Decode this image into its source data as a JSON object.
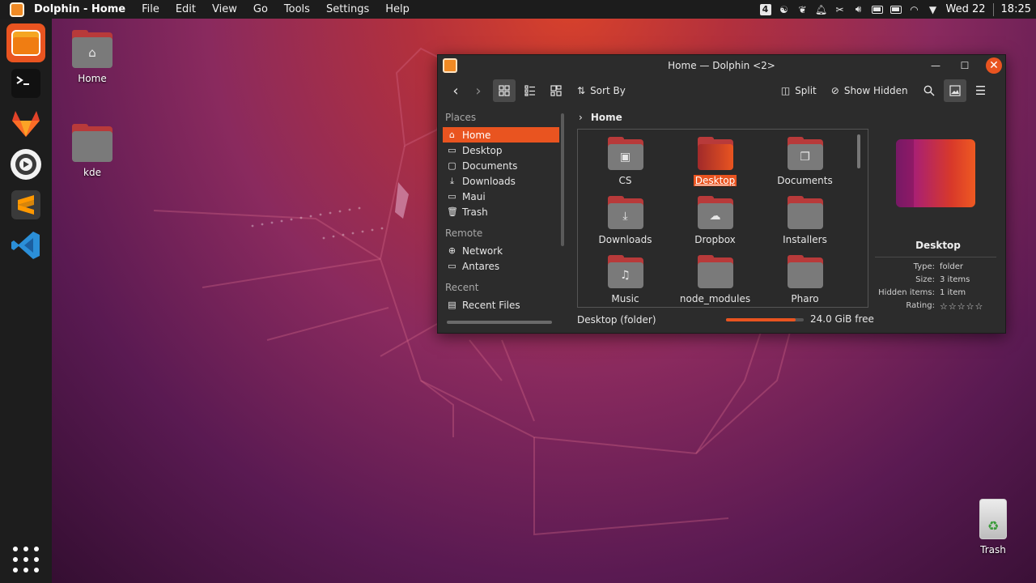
{
  "topbar": {
    "app_title": "Dolphin - Home",
    "menu": [
      "File",
      "Edit",
      "View",
      "Go",
      "Tools",
      "Settings",
      "Help"
    ],
    "tray_badge": "4",
    "clock_day": "Wed 22",
    "clock_time": "18:25"
  },
  "desktop": {
    "icons": [
      {
        "label": "Home"
      },
      {
        "label": "kde"
      }
    ],
    "trash_label": "Trash"
  },
  "window": {
    "title": "Home — Dolphin <2>",
    "toolbar": {
      "sort_label": "Sort By",
      "split_label": "Split",
      "show_hidden_label": "Show Hidden"
    },
    "sidebar": {
      "places_heading": "Places",
      "places": [
        {
          "label": "Home",
          "icon": "home-icon"
        },
        {
          "label": "Desktop",
          "icon": "desktop-icon"
        },
        {
          "label": "Documents",
          "icon": "documents-icon"
        },
        {
          "label": "Downloads",
          "icon": "downloads-icon"
        },
        {
          "label": "Maui",
          "icon": "folder-icon"
        },
        {
          "label": "Trash",
          "icon": "trash-icon"
        }
      ],
      "remote_heading": "Remote",
      "remote": [
        {
          "label": "Network",
          "icon": "network-icon"
        },
        {
          "label": "Antares",
          "icon": "folder-icon"
        }
      ],
      "recent_heading": "Recent",
      "recent": [
        {
          "label": "Recent Files",
          "icon": "recent-files-icon"
        }
      ]
    },
    "breadcrumb": "Home",
    "files": [
      {
        "name": "CS",
        "icon": "terminal-folder-icon"
      },
      {
        "name": "Desktop",
        "icon": "desktop-folder-icon"
      },
      {
        "name": "Documents",
        "icon": "documents-folder-icon"
      },
      {
        "name": "Downloads",
        "icon": "downloads-folder-icon"
      },
      {
        "name": "Dropbox",
        "icon": "cloud-folder-icon"
      },
      {
        "name": "Installers",
        "icon": "folder-icon"
      },
      {
        "name": "Music",
        "icon": "music-folder-icon"
      },
      {
        "name": "node_modules",
        "icon": "folder-icon"
      },
      {
        "name": "Pharo",
        "icon": "folder-icon"
      }
    ],
    "status": {
      "selection": "Desktop (folder)",
      "free_space": "24.0 GiB free",
      "used_fraction": 0.9
    },
    "info_panel": {
      "name": "Desktop",
      "rows": [
        {
          "key": "Type:",
          "value": "folder"
        },
        {
          "key": "Size:",
          "value": "3 items"
        },
        {
          "key": "Hidden items:",
          "value": "1 item"
        },
        {
          "key": "Rating:",
          "value": "☆☆☆☆☆"
        }
      ]
    }
  },
  "colors": {
    "accent": "#e95420",
    "panel_bg": "#2c2c2c",
    "topbar_bg": "#1c1c1c",
    "dock_bg": "#1d1d1d"
  }
}
